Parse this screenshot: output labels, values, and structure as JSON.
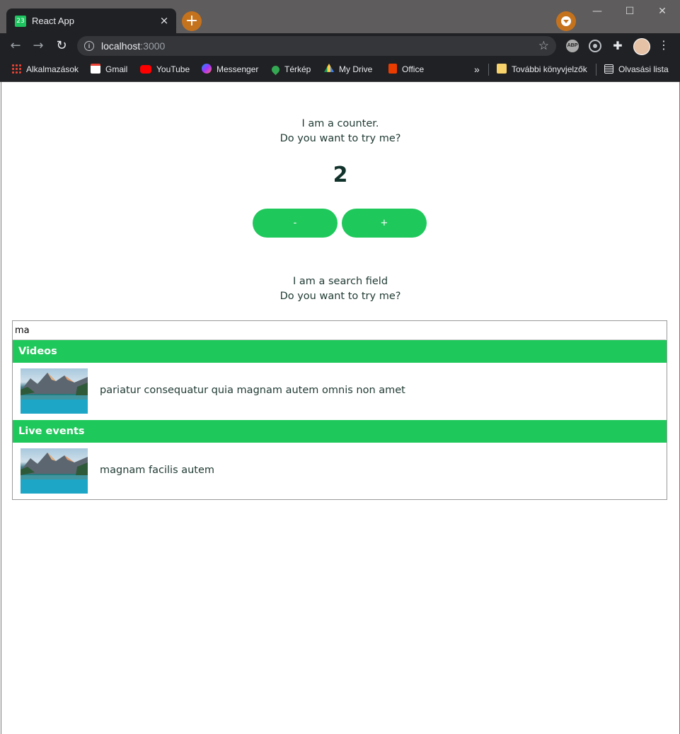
{
  "browser": {
    "tab_title": "React App",
    "tab_favicon_text": "23",
    "tab_close": "×",
    "new_tab": "+",
    "window_controls": [
      "—",
      "☐",
      "✕"
    ],
    "url_host": "localhost",
    "url_port": ":3000",
    "nav": {
      "back": "←",
      "forward": "→",
      "reload": "↻"
    },
    "ext_abp": "ABP"
  },
  "bookmarks": [
    {
      "label": "Alkalmazások",
      "icon": "apps-icon"
    },
    {
      "label": "Gmail",
      "icon": "gmail-icon"
    },
    {
      "label": "YouTube",
      "icon": "youtube-icon"
    },
    {
      "label": "Messenger",
      "icon": "messenger-icon"
    },
    {
      "label": "Térkép",
      "icon": "maps-icon"
    },
    {
      "label": "My Drive",
      "icon": "drive-icon"
    },
    {
      "label": "Office",
      "icon": "office-icon"
    }
  ],
  "bookmarks_overflow": "»",
  "other_bookmarks": "További könyvjelzők",
  "reading_list": "Olvasási lista",
  "counter": {
    "line1": "I am a counter.",
    "line2": "Do you want to try me?",
    "value": "2",
    "decrement_label": "-",
    "increment_label": "+"
  },
  "search": {
    "line1": "I am a search field",
    "line2": "Do you want to try me?",
    "query": "ma",
    "sections": [
      {
        "title": "Videos",
        "items": [
          "pariatur consequatur quia magnam autem omnis non amet"
        ]
      },
      {
        "title": "Live events",
        "items": [
          "magnam facilis autem"
        ]
      }
    ]
  },
  "colors": {
    "accent": "#1fc85b",
    "text": "#1f3a33"
  }
}
